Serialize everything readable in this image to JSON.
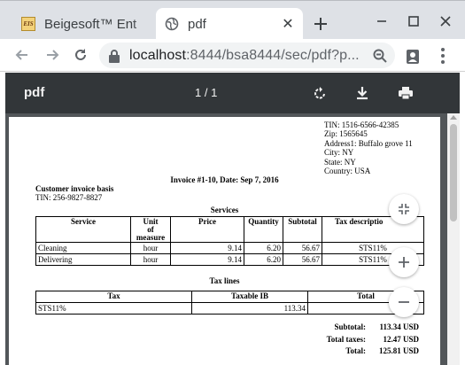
{
  "browser": {
    "tabs": [
      {
        "title": "Beigesoft™ Ent",
        "favicon_text": "EIS",
        "active": false
      },
      {
        "title": "pdf",
        "active": true
      }
    ],
    "url_host": "localhost",
    "url_rest": ":8444/bsa8444/sec/pdf?p..."
  },
  "pdf_toolbar": {
    "title": "pdf",
    "page_indicator": "1 / 1"
  },
  "document": {
    "seller": [
      "TIN: 1516-6566-42385",
      "Zip: 1565645",
      "Address1: Buffalo grove 11",
      "City: NY",
      "State: NY",
      "Country: USA"
    ],
    "invoice_title": "Invoice #1-10, Date: Sep 7, 2016",
    "buyer_title": "Customer invoice basis",
    "buyer_tin": "TIN: 256-9827-8827",
    "services_title": "Services",
    "services_headers": {
      "service": "Service",
      "unit1": "Unit",
      "unit2": "of",
      "unit3": "measure",
      "price": "Price",
      "quantity": "Quantity",
      "subtotal": "Subtotal",
      "tax": "Tax descriptio"
    },
    "services_rows": [
      {
        "service": "Cleaning",
        "unit": "hour",
        "price": "9.14",
        "quantity": "6.20",
        "subtotal": "56.67",
        "tax": "STS11%"
      },
      {
        "service": "Delivering",
        "unit": "hour",
        "price": "9.14",
        "quantity": "6.20",
        "subtotal": "56.67",
        "tax": "STS11%"
      }
    ],
    "tax_title": "Tax lines",
    "tax_headers": {
      "tax": "Tax",
      "taxable": "Taxable IB",
      "total": "Total"
    },
    "tax_rows": [
      {
        "tax": "STS11%",
        "taxable": "113.34",
        "total": ""
      }
    ],
    "totals": [
      {
        "label": "Subtotal:",
        "value": "113.34 USD"
      },
      {
        "label": "Total taxes:",
        "value": "12.47 USD"
      },
      {
        "label": "Total:",
        "value": "125.81 USD"
      }
    ]
  },
  "colors": {
    "tabstrip": "#dee1e6",
    "pdf_toolbar": "#323639",
    "viewer_background": "#525659"
  }
}
